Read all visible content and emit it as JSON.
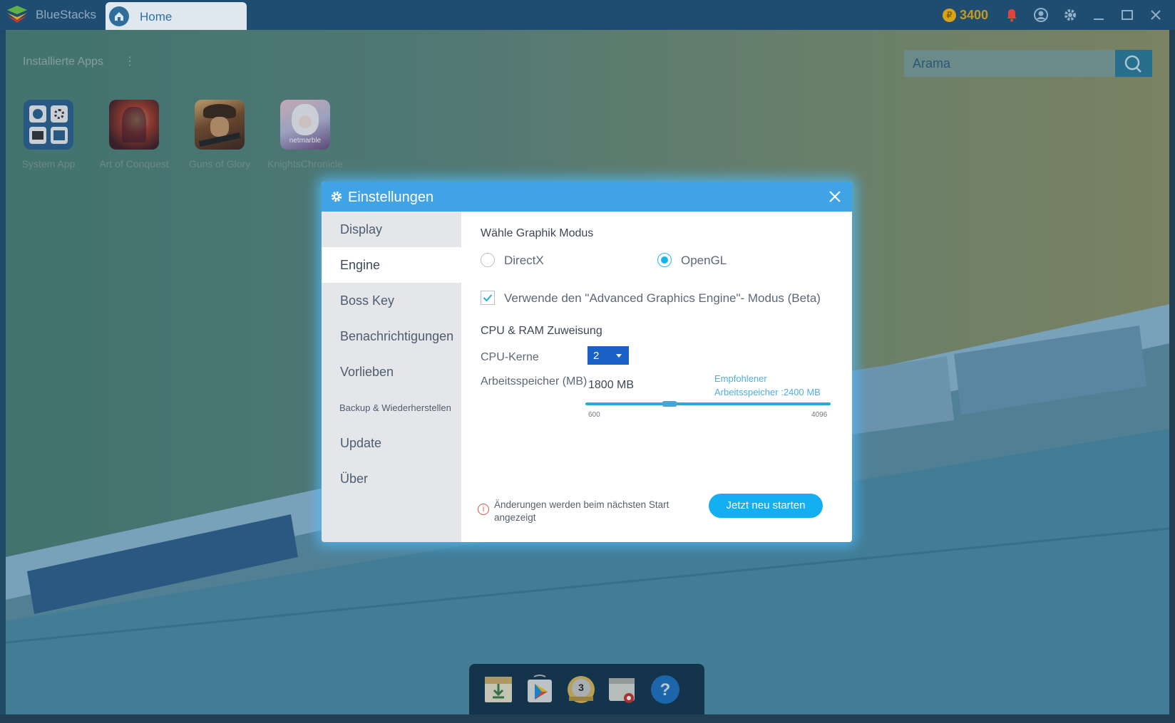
{
  "window": {
    "app_name": "BlueStacks",
    "tab_label": "Home",
    "coins": "3400",
    "coin_symbol": "₽"
  },
  "desktop": {
    "installed_apps_label": "Installierte Apps",
    "menu_dots": "⋮",
    "search_placeholder": "Arama",
    "apps": [
      {
        "name": "System App"
      },
      {
        "name": "Art of Conquest"
      },
      {
        "name": "Guns of Glory"
      },
      {
        "name": "KnightsChronicle",
        "badge": "netmarble"
      }
    ],
    "dock": [
      "download-icon",
      "play-store-icon",
      "level-badge-icon",
      "apk-icon",
      "help-icon"
    ],
    "dock_level": "3",
    "dock_help": "?"
  },
  "dialog": {
    "title": "Einstellungen",
    "sidebar": [
      {
        "label": "Display"
      },
      {
        "label": "Engine",
        "active": true
      },
      {
        "label": "Boss Key"
      },
      {
        "label": "Benachrichtigungen"
      },
      {
        "label": "Vorlieben"
      },
      {
        "label": "Backup & Wiederherstellen"
      },
      {
        "label": "Update"
      },
      {
        "label": "Über"
      }
    ],
    "engine": {
      "graphics_heading": "Wähle Graphik Modus",
      "option_directx": "DirectX",
      "option_opengl": "OpenGL",
      "selected_mode": "OpenGL",
      "advanced_label": "Verwende den \"Advanced Graphics Engine\"- Modus (Beta)",
      "advanced_checked": true,
      "cpu_ram_heading": "CPU & RAM Zuweisung",
      "cpu_label": "CPU-Kerne",
      "cpu_value": "2",
      "ram_label": "Arbeitsspeicher (MB)",
      "ram_value": "1800 MB",
      "ram_recommended_line1": "Empfohlener",
      "ram_recommended_line2": "Arbeitsspeicher :2400 MB",
      "ram_min": "600",
      "ram_max": "4096",
      "ram_current": 1800,
      "info_text": "Änderungen werden beim nächsten Start angezeigt",
      "restart_button": "Jetzt neu starten"
    }
  },
  "colors": {
    "accent": "#3fa3e6",
    "button": "#13aff0",
    "select": "#1a62c8"
  }
}
